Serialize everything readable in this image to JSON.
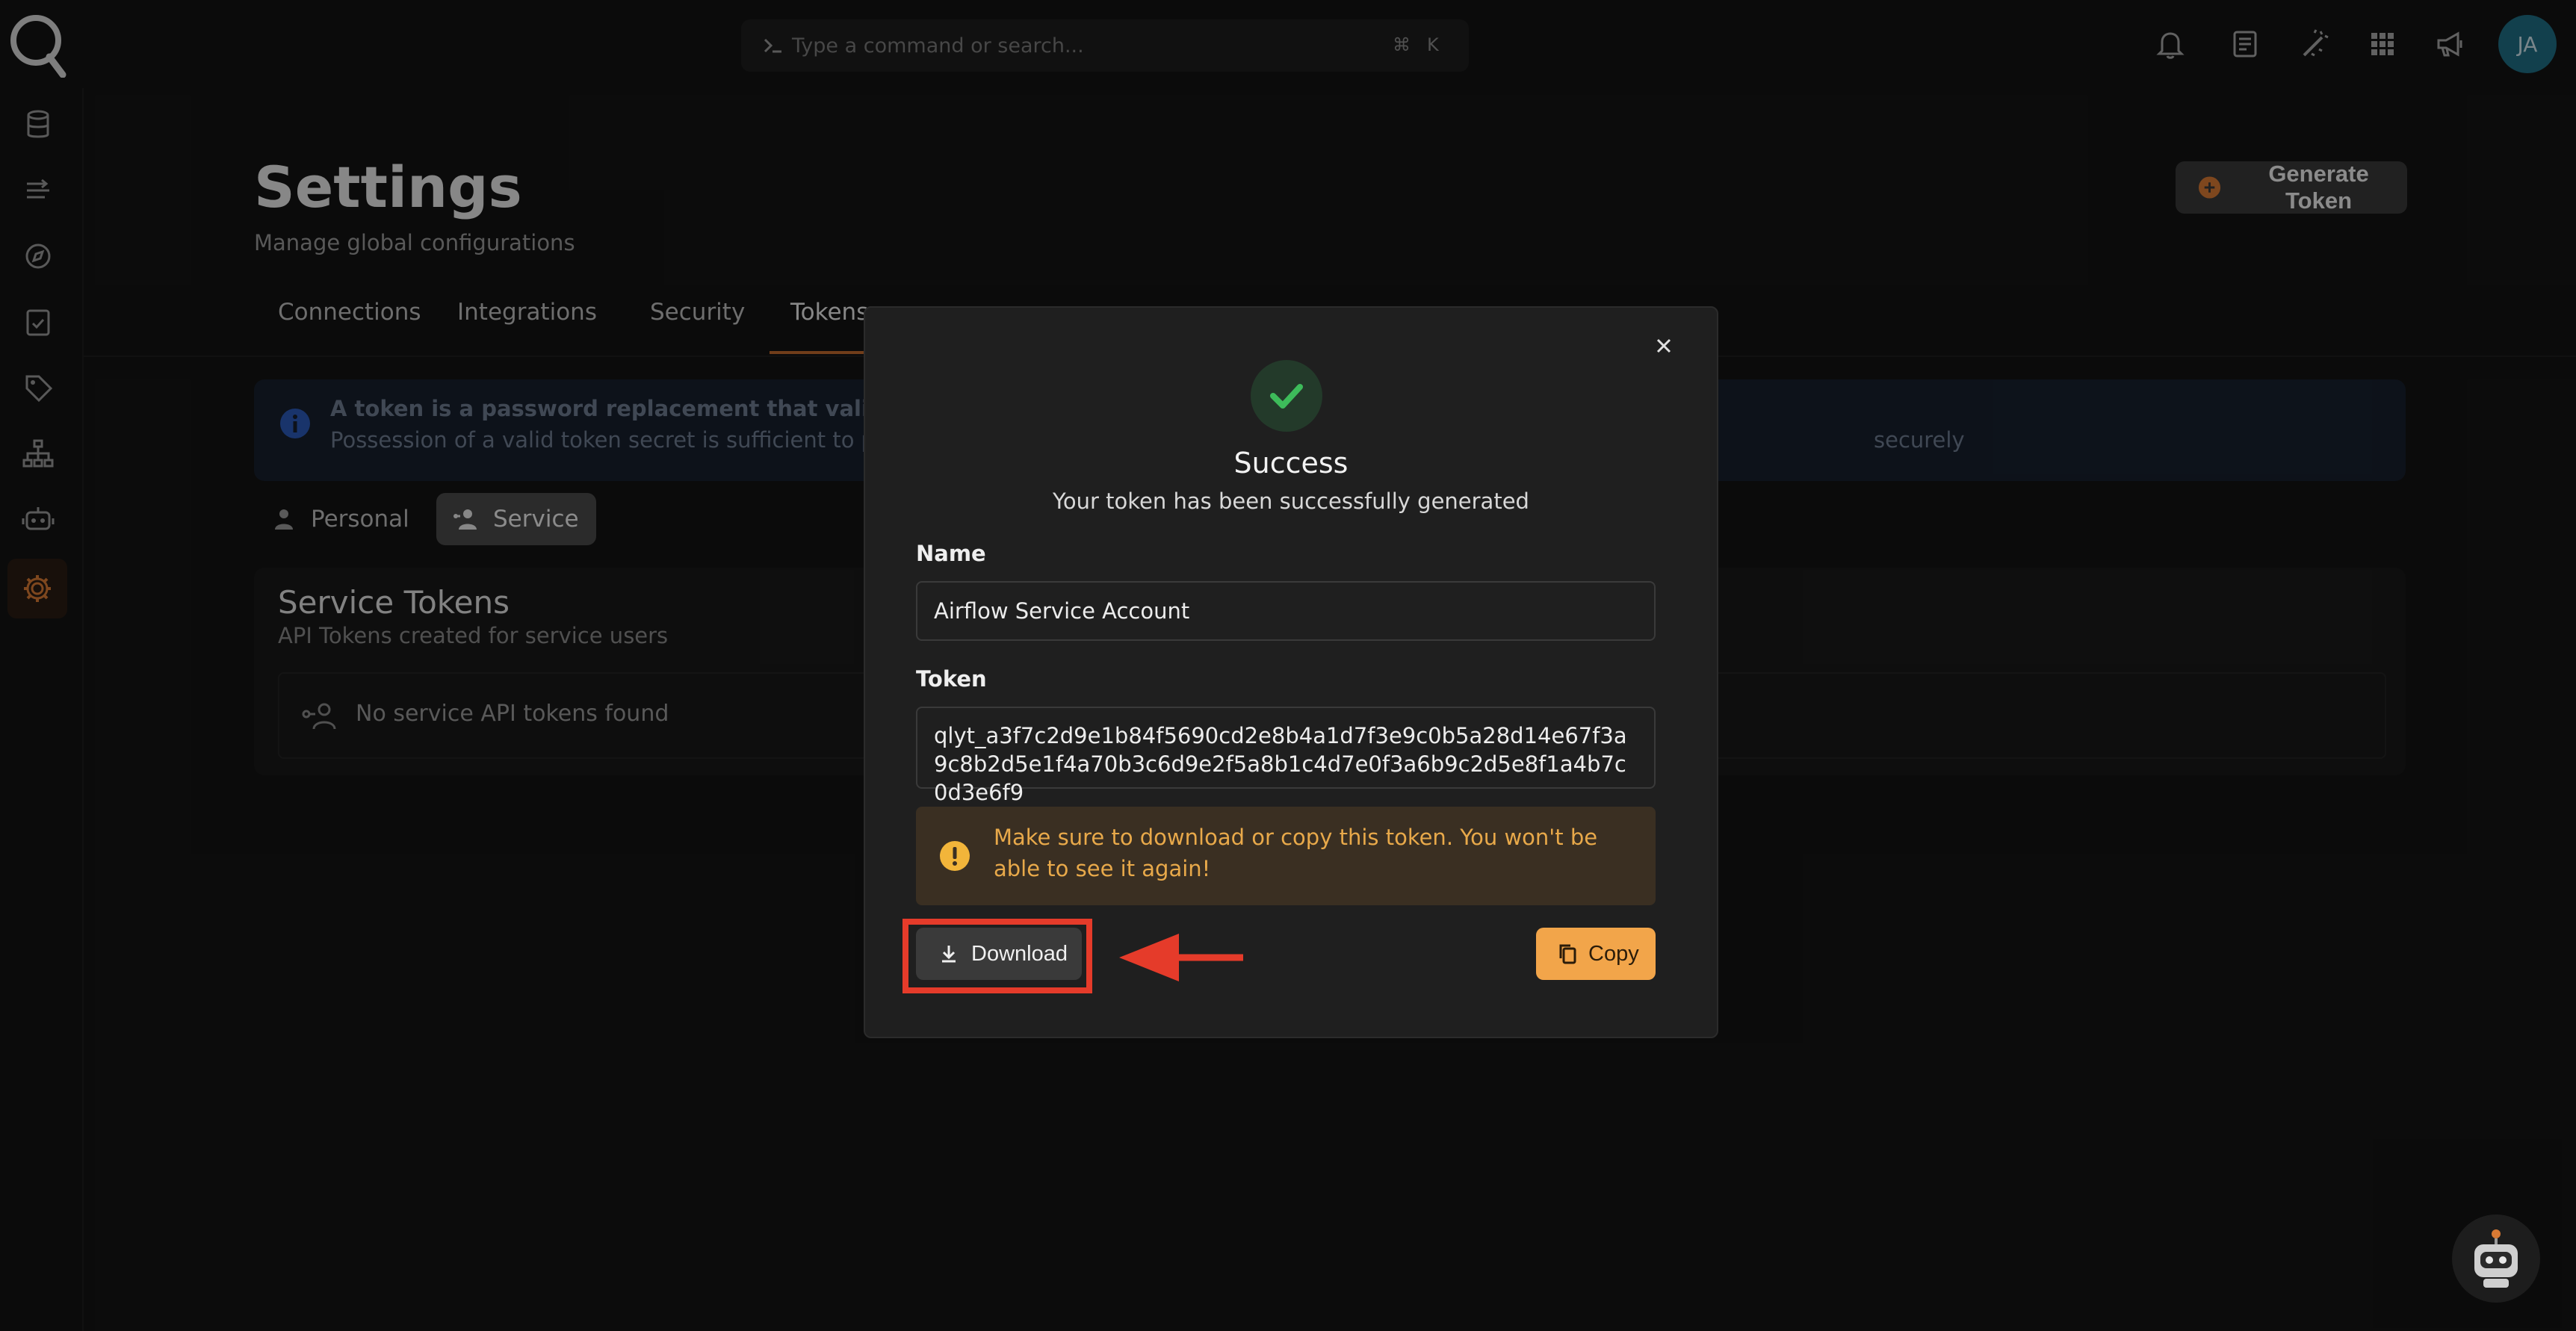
{
  "topbar": {
    "search_placeholder": "Type a command or search...",
    "shortcut_key1": "⌘",
    "shortcut_key2": "K",
    "avatar_initials": "JA"
  },
  "header": {
    "title": "Settings",
    "subtitle": "Manage global configurations",
    "generate_button": "Generate Token"
  },
  "tabs": [
    "Connections",
    "Integrations",
    "Security",
    "Tokens"
  ],
  "info_banner": {
    "line1": "A token is a password replacement that validates your",
    "line2": "Possession of a valid token secret is sufficient to perform",
    "line2_end": "securely"
  },
  "segments": {
    "personal": "Personal",
    "service": "Service"
  },
  "service_tokens": {
    "title": "Service Tokens",
    "subtitle": "API Tokens created for service users",
    "empty": "No service API tokens found"
  },
  "modal": {
    "title": "Success",
    "subtitle": "Your token has been successfully generated",
    "name_label": "Name",
    "name_value": "Airflow Service Account",
    "token_label": "Token",
    "token_value": "qlyt_a3f7c2d9e1b84f5690cd2e8b4a1d7f3e9c0b5a28d14e67f3a9c8b2d5e1f4a70b3c6d9e2f5a8b1c4d7e0f3a6b9c2d5e8f1a4b7c0d3e6f9",
    "warning": "Make sure to download or copy this token. You won't be able to see it again!",
    "download_button": "Download",
    "copy_button": "Copy"
  },
  "colors": {
    "accent": "#f2a54a",
    "highlight": "#e53b2a",
    "success": "#3dbb5a"
  }
}
